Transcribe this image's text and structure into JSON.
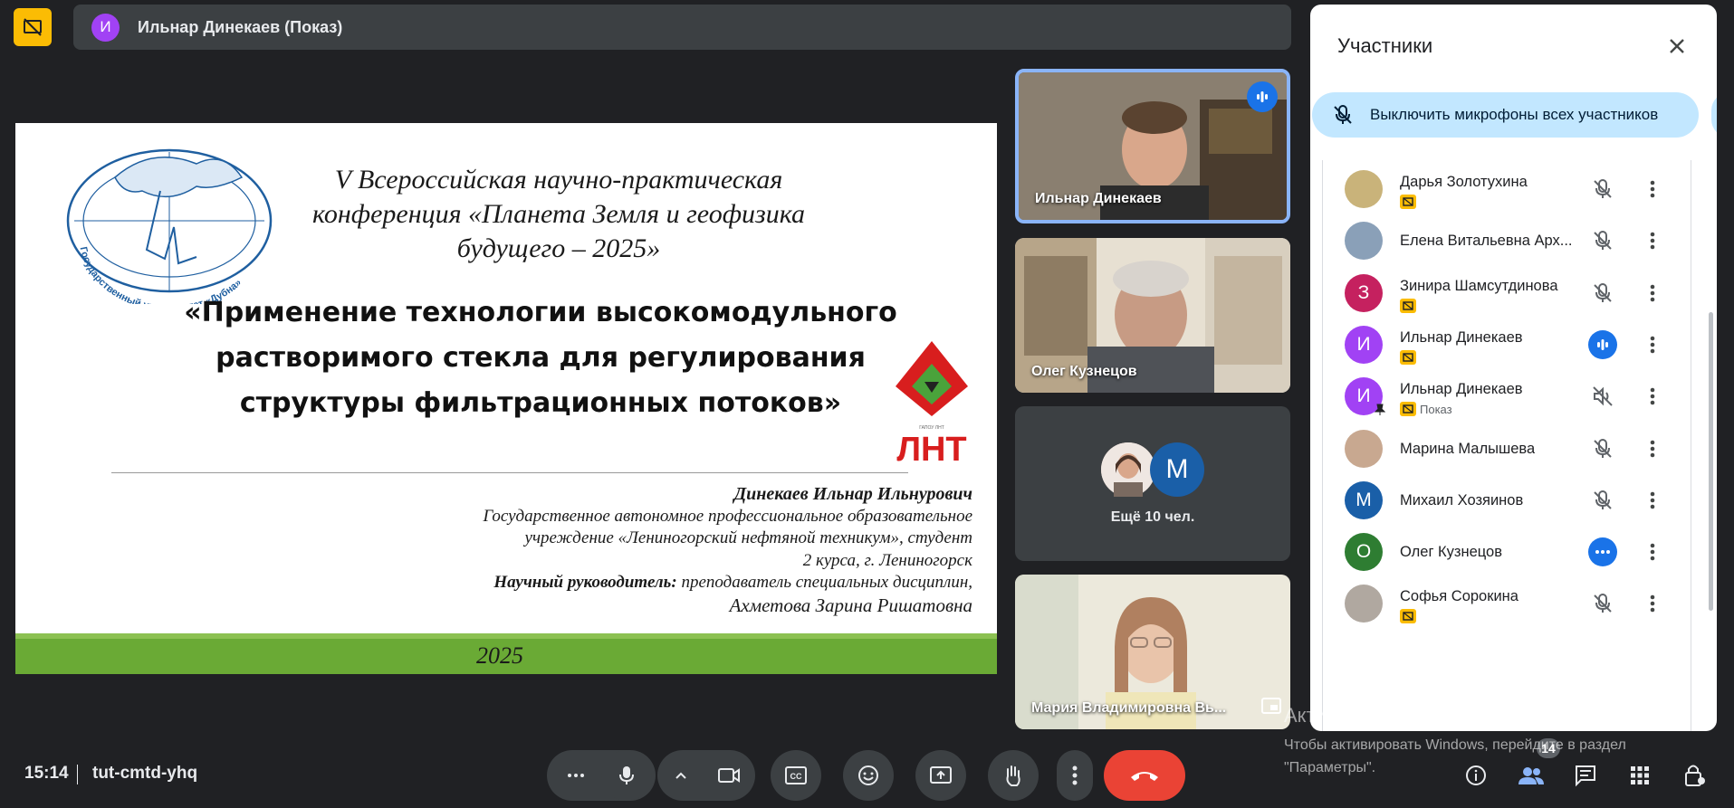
{
  "presenter_bar": {
    "avatar_letter": "И",
    "name": "Ильнар Динекаев (Показ)"
  },
  "slide": {
    "conference_title": "V Всероссийская научно-практическая конференция «Планета Земля и геофизика будущего – 2025»",
    "logo_text": "Государственный университет «Дубна»",
    "talk_title": "«Применение технологии высокомодульного растворимого стекла для регулирования структуры фильтрационных потоков»",
    "lnt_logo": "ЛНТ",
    "author": "Динекаев Ильнар Ильнурович",
    "affiliation_1": "Государственное автономное профессиональное образовательное",
    "affiliation_2": "учреждение «Лениногорский нефтяной техникум», студент",
    "affiliation_3": "2 курса, г. Лениногорск",
    "supervisor_label": "Научный руководитель:",
    "supervisor_role": " преподаватель специальных дисциплин,",
    "supervisor_name": "Ахметова Зарина Ришатовна",
    "year": "2025"
  },
  "tiles": [
    {
      "name": "Ильнар Динекаев",
      "active": true
    },
    {
      "name": "Олег Кузнецов"
    },
    {
      "more_letter": "М",
      "more_label": "Ещё 10 чел."
    },
    {
      "name": "Мария Владимировна Вь..."
    }
  ],
  "bottom": {
    "time": "15:14",
    "meeting_code": "tut-cmtd-yhq",
    "people_count": "14"
  },
  "panel": {
    "title": "Участники",
    "mute_all_label": "Выключить микрофоны всех участников",
    "participants": [
      {
        "name": "Дарья Золотухина",
        "letter": "",
        "color": "#c9b37a",
        "tag": true,
        "tag_text": "",
        "mic": "muted"
      },
      {
        "name": "Елена Витальевна Арх...",
        "letter": "",
        "color": "#8aa0b8",
        "tag": false,
        "tag_text": "",
        "mic": "muted"
      },
      {
        "name": "Зинира Шамсутдинова",
        "letter": "З",
        "color": "#c5215f",
        "tag": true,
        "tag_text": "",
        "mic": "muted"
      },
      {
        "name": "Ильнар Динекаев",
        "letter": "И",
        "color": "#a142f4",
        "tag": true,
        "tag_text": "",
        "mic": "speaking"
      },
      {
        "name": "Ильнар Динекаев",
        "letter": "И",
        "color": "#a142f4",
        "tag": true,
        "tag_text": "Показ",
        "mic": "off-audio"
      },
      {
        "name": "Марина Малышева",
        "letter": "",
        "color": "#c8a890",
        "tag": false,
        "tag_text": "",
        "mic": "muted"
      },
      {
        "name": "Михаил Хозяинов",
        "letter": "М",
        "color": "#1a5fa8",
        "tag": false,
        "tag_text": "",
        "mic": "muted"
      },
      {
        "name": "Олег Кузнецов",
        "letter": "О",
        "color": "#2e7d32",
        "tag": false,
        "tag_text": "",
        "mic": "dots"
      },
      {
        "name": "Софья Сорокина",
        "letter": "",
        "color": "#b0a8a0",
        "tag": true,
        "tag_text": "",
        "mic": "muted"
      }
    ]
  },
  "watermark": {
    "title": "Активация Windows",
    "line1": "Чтобы активировать Windows, перейдите в раздел",
    "line2": "\"Параметры\"."
  }
}
